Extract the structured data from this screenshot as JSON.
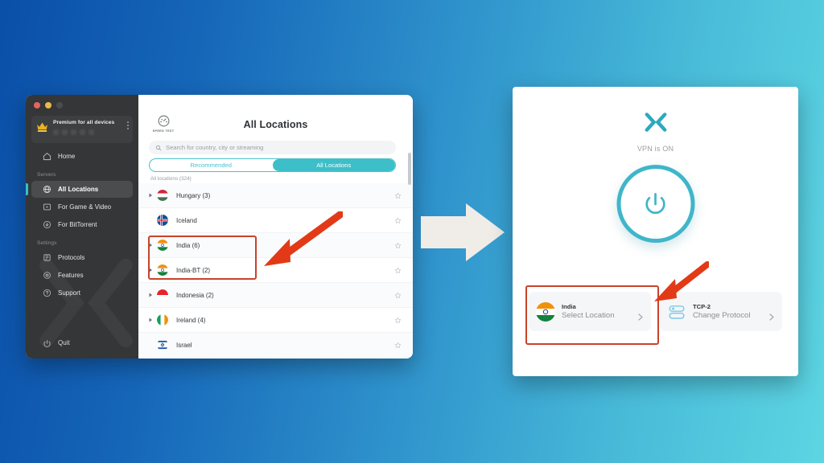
{
  "background": {
    "gradient_from": "#0a4fa8",
    "gradient_to": "#5dd5e2"
  },
  "accents": {
    "teal": "#3cbfc8",
    "annotation_red": "#c8432a",
    "crown_gold": "#e8b425"
  },
  "app_window": {
    "titlebar": {
      "buttons": [
        "close",
        "minimize",
        "zoom"
      ]
    },
    "sidebar": {
      "account": {
        "label": "Premium for all devices",
        "icon": "crown-icon",
        "menu_icon": "kebab-menu-icon"
      },
      "items": [
        {
          "label": "Home",
          "icon": "home-icon",
          "active": false,
          "section": null
        },
        {
          "label": "All Locations",
          "icon": "globe-icon",
          "active": true,
          "section": "Servers"
        },
        {
          "label": "For Game & Video",
          "icon": "video-icon",
          "active": false,
          "section": "Servers"
        },
        {
          "label": "For BitTorrent",
          "icon": "download-icon",
          "active": false,
          "section": "Servers"
        },
        {
          "label": "Protocols",
          "icon": "protocol-icon",
          "active": false,
          "section": "Settings"
        },
        {
          "label": "Features",
          "icon": "gear-icon",
          "active": false,
          "section": "Settings"
        },
        {
          "label": "Support",
          "icon": "help-icon",
          "active": false,
          "section": "Settings"
        }
      ],
      "sections": {
        "servers": "Servers",
        "settings": "Settings"
      },
      "quit": {
        "label": "Quit",
        "icon": "power-icon"
      }
    },
    "main": {
      "speedtest": {
        "label": "SPEED TEST",
        "icon": "speedometer-icon"
      },
      "title": "All Locations",
      "search": {
        "value": "",
        "placeholder": "Search for country, city or streaming",
        "icon": "search-icon"
      },
      "tabs": [
        {
          "label": "Recommended",
          "selected": false
        },
        {
          "label": "All Locations",
          "selected": true
        }
      ],
      "list_header": "All locations (324)",
      "rows": [
        {
          "name": "Hungary (3)",
          "expandable": true,
          "flag": "hungary"
        },
        {
          "name": "Iceland",
          "expandable": false,
          "flag": "iceland"
        },
        {
          "name": "India (6)",
          "expandable": true,
          "flag": "india"
        },
        {
          "name": "India-BT (2)",
          "expandable": true,
          "flag": "india"
        },
        {
          "name": "Indonesia (2)",
          "expandable": true,
          "flag": "indonesia"
        },
        {
          "name": "Ireland (4)",
          "expandable": true,
          "flag": "ireland"
        },
        {
          "name": "Israel",
          "expandable": false,
          "flag": "israel"
        }
      ]
    }
  },
  "flow": {
    "arrow_icon": "right-arrow-icon"
  },
  "vpn_window": {
    "logo": "x-vpn-logo-icon",
    "status": "VPN is ON",
    "power_button": {
      "icon": "power-icon",
      "state": "on"
    },
    "cards": [
      {
        "title": "India",
        "subtitle": "Select Location",
        "icon": "india-flag-icon",
        "chevron": "chevron-right-icon"
      },
      {
        "title": "TCP-2",
        "subtitle": "Change Protocol",
        "icon": "protocol-toggle-icon",
        "chevron": "chevron-right-icon"
      }
    ]
  },
  "annotations": {
    "left_box": "highlights India and India-BT rows",
    "right_box": "highlights Select Location card",
    "arrows": [
      "arrow-pointing-to-india-rows",
      "arrow-pointing-to-select-location-card"
    ]
  }
}
